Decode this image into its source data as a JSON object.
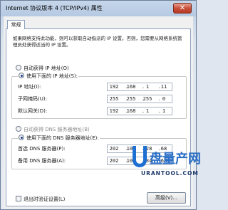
{
  "window": {
    "title": "Internet 协议版本 4 (TCP/IPv4) 属性",
    "close_label": "✕"
  },
  "tab": {
    "label": "常规"
  },
  "description": "如果网络支持此功能，则可以获取自动指派的 IP 设置。否则，您需要从网络系统管理员处获得适当的 IP 设置。",
  "ip_mode": {
    "auto_label": "自动获得 IP 地址(O)",
    "manual_label": "使用下面的 IP 地址(S):",
    "selected": "manual"
  },
  "ip_fields": [
    {
      "label": "IP 地址(I):",
      "octets": [
        "192",
        "168",
        "1",
        "11"
      ]
    },
    {
      "label": "子网掩码(U):",
      "octets": [
        "255",
        "255",
        "255",
        "0"
      ]
    },
    {
      "label": "默认网关(D):",
      "octets": [
        "192",
        "168",
        "1",
        "1"
      ]
    }
  ],
  "dns_mode": {
    "auto_label": "自动获得 DNS 服务器地址(B)",
    "manual_label": "使用下面的 DNS 服务器地址(E):",
    "selected": "manual"
  },
  "dns_fields": [
    {
      "label": "首选 DNS 服务器(P):",
      "octets": [
        "202",
        "102",
        "128",
        "68"
      ]
    },
    {
      "label": "备用 DNS 服务器(A):",
      "octets": [
        "202",
        "102",
        "134",
        "68"
      ]
    }
  ],
  "validate_checkbox": {
    "label": "退出时验证设置(L)",
    "checked": false
  },
  "advanced_button": {
    "label": "高级(V)..."
  },
  "watermark": {
    "brand": "盘量产网",
    "url": "URANTOOL.COM"
  }
}
